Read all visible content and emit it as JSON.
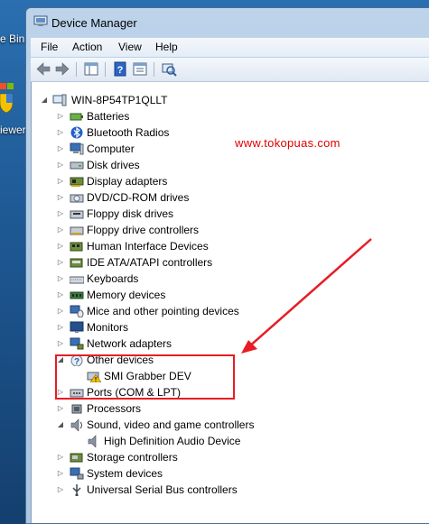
{
  "desktop": {
    "label_1": "e Bin",
    "label_2": "iewer"
  },
  "window": {
    "title": "Device Manager"
  },
  "menu": [
    "File",
    "Action",
    "View",
    "Help"
  ],
  "annotation": {
    "url": "www.tokopuas.com"
  },
  "tree": {
    "root": "WIN-8P54TP1QLLT",
    "items": [
      {
        "label": "Batteries",
        "icon": "battery-icon"
      },
      {
        "label": "Bluetooth Radios",
        "icon": "bluetooth-icon"
      },
      {
        "label": "Computer",
        "icon": "computer-icon"
      },
      {
        "label": "Disk drives",
        "icon": "disk-drive-icon"
      },
      {
        "label": "Display adapters",
        "icon": "display-adapter-icon"
      },
      {
        "label": "DVD/CD-ROM drives",
        "icon": "dvd-drive-icon"
      },
      {
        "label": "Floppy disk drives",
        "icon": "floppy-drive-icon"
      },
      {
        "label": "Floppy drive controllers",
        "icon": "floppy-controller-icon"
      },
      {
        "label": "Human Interface Devices",
        "icon": "hid-icon"
      },
      {
        "label": "IDE ATA/ATAPI controllers",
        "icon": "ide-controller-icon"
      },
      {
        "label": "Keyboards",
        "icon": "keyboard-icon"
      },
      {
        "label": "Memory devices",
        "icon": "memory-icon"
      },
      {
        "label": "Mice and other pointing devices",
        "icon": "mouse-icon"
      },
      {
        "label": "Monitors",
        "icon": "monitor-icon"
      },
      {
        "label": "Network adapters",
        "icon": "network-adapter-icon"
      },
      {
        "label": "Other devices",
        "icon": "unknown-device-icon",
        "expanded": true
      },
      {
        "label": "SMI Grabber DEV",
        "icon": "warning-device-icon",
        "child": true
      },
      {
        "label": "Ports (COM & LPT)",
        "icon": "port-icon"
      },
      {
        "label": "Processors",
        "icon": "processor-icon"
      },
      {
        "label": "Sound, video and game controllers",
        "icon": "sound-icon",
        "expanded": true
      },
      {
        "label": "High Definition Audio Device",
        "icon": "speaker-icon",
        "child": true
      },
      {
        "label": "Storage controllers",
        "icon": "storage-controller-icon"
      },
      {
        "label": "System devices",
        "icon": "system-device-icon"
      },
      {
        "label": "Universal Serial Bus controllers",
        "icon": "usb-icon"
      }
    ]
  }
}
